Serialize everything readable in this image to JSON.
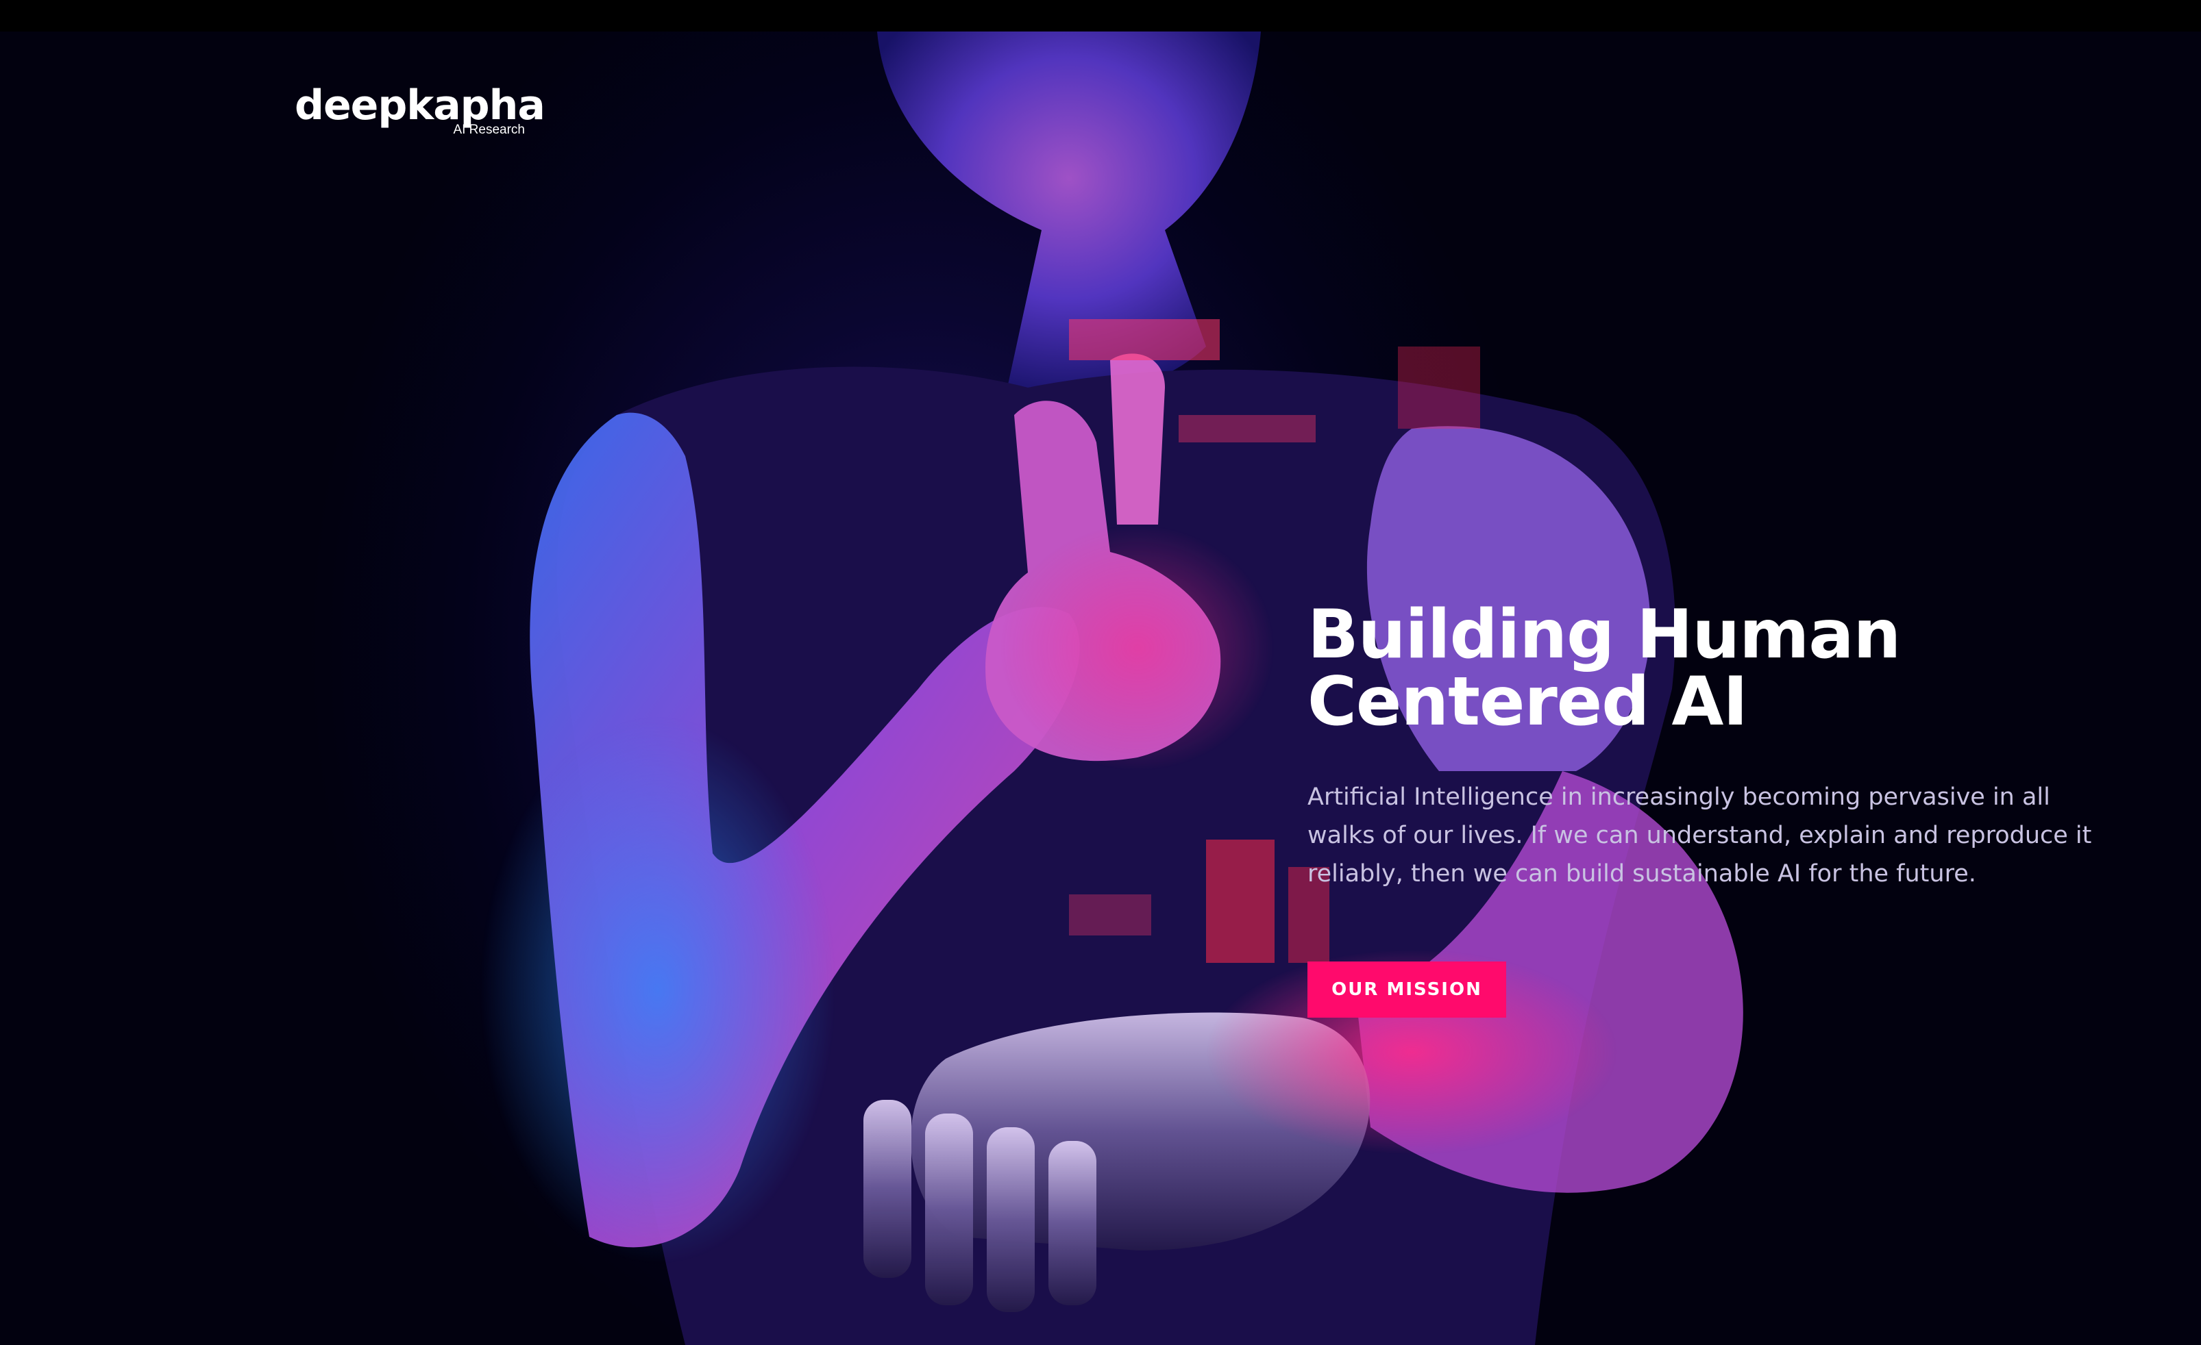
{
  "brand": {
    "name": "deepkapha",
    "tagline": "AI Research"
  },
  "hero": {
    "headline_line1": "Building Human",
    "headline_line2": "Centered AI",
    "description": "Artificial Intelligence in increasingly becoming pervasive in all walks of our lives. If we can understand, explain and reproduce it reliably, then we can build sustainable AI for the future.",
    "cta_label": "OUR MISSION"
  },
  "colors": {
    "accent": "#ff0a6c",
    "background": "#05031a",
    "text": "#ffffff",
    "muted_text": "#c9c3e2"
  },
  "image": {
    "subject": "hero-background-photo"
  }
}
